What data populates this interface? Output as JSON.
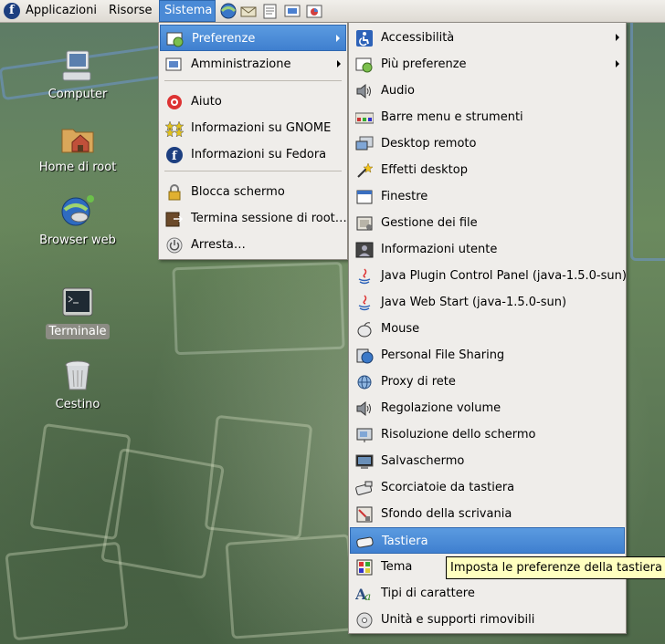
{
  "panel": {
    "menus": [
      "Applicazioni",
      "Risorse",
      "Sistema"
    ],
    "active_menu": "Sistema",
    "launchers": [
      "browser-icon",
      "mail-icon",
      "writer-icon",
      "impress-icon",
      "calc-icon"
    ]
  },
  "desktop": {
    "icons": [
      {
        "label": "Computer",
        "icon": "computer-icon"
      },
      {
        "label": "Home di root",
        "icon": "home-folder-icon"
      },
      {
        "label": "Browser web",
        "icon": "web-browser-icon"
      },
      {
        "label": "Terminale",
        "icon": "terminal-icon"
      },
      {
        "label": "Cestino",
        "icon": "trash-icon"
      }
    ]
  },
  "sistema_menu": {
    "items": [
      {
        "label": "Preferenze",
        "icon": "preferences-icon",
        "submenu": true
      },
      {
        "label": "Amministrazione",
        "icon": "administration-icon",
        "submenu": true
      },
      {
        "label": "Aiuto",
        "icon": "help-icon"
      },
      {
        "label": "Informazioni su GNOME",
        "icon": "gnome-footprint-icon"
      },
      {
        "label": "Informazioni su Fedora",
        "icon": "fedora-icon"
      },
      {
        "label": "Blocca schermo",
        "icon": "lock-icon"
      },
      {
        "label": "Termina sessione di root…",
        "icon": "logout-icon"
      },
      {
        "label": "Arresta…",
        "icon": "shutdown-icon"
      }
    ]
  },
  "preferenze_menu": {
    "items": [
      {
        "label": "Accessibilità",
        "icon": "accessibility-icon",
        "submenu": true
      },
      {
        "label": "Più preferenze",
        "icon": "more-preferences-icon",
        "submenu": true
      },
      {
        "label": "Audio",
        "icon": "speaker-icon"
      },
      {
        "label": "Barre menu e strumenti",
        "icon": "toolbar-icon"
      },
      {
        "label": "Desktop remoto",
        "icon": "remote-desktop-icon"
      },
      {
        "label": "Effetti desktop",
        "icon": "magic-wand-icon"
      },
      {
        "label": "Finestre",
        "icon": "window-icon"
      },
      {
        "label": "Gestione dei file",
        "icon": "file-manager-icon"
      },
      {
        "label": "Informazioni utente",
        "icon": "user-info-icon"
      },
      {
        "label": "Java Plugin Control Panel (java-1.5.0-sun)",
        "icon": "java-icon"
      },
      {
        "label": "Java Web Start (java-1.5.0-sun)",
        "icon": "java-icon"
      },
      {
        "label": "Mouse",
        "icon": "mouse-icon"
      },
      {
        "label": "Personal File Sharing",
        "icon": "file-sharing-icon"
      },
      {
        "label": "Proxy di rete",
        "icon": "network-proxy-icon"
      },
      {
        "label": "Regolazione volume",
        "icon": "volume-icon"
      },
      {
        "label": "Risoluzione dello schermo",
        "icon": "screen-resolution-icon"
      },
      {
        "label": "Salvaschermo",
        "icon": "screensaver-icon"
      },
      {
        "label": "Scorciatoie da tastiera",
        "icon": "keyboard-shortcuts-icon"
      },
      {
        "label": "Sfondo della scrivania",
        "icon": "wallpaper-icon"
      },
      {
        "label": "Tastiera",
        "icon": "keyboard-icon"
      },
      {
        "label": "Tema",
        "icon": "theme-icon"
      },
      {
        "label": "Tipi di carattere",
        "icon": "font-icon"
      },
      {
        "label": "Unità e supporti rimovibili",
        "icon": "removable-media-icon"
      }
    ],
    "highlighted": "Tastiera"
  },
  "tooltip": {
    "text": "Imposta le preferenze della tastiera"
  },
  "colors": {
    "highlight": "#4a8ad6",
    "menu_bg": "#efedea",
    "tooltip_bg": "#ffffbf"
  }
}
